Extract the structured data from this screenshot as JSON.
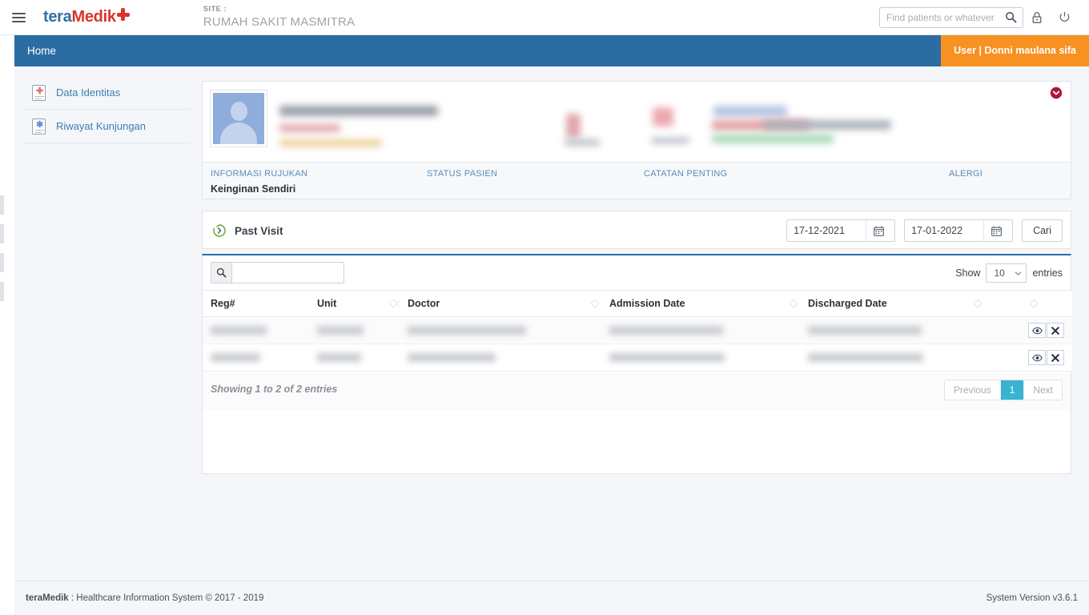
{
  "topbar": {
    "menu_icon": "hamburger-icon",
    "brand_part1": "teraMedik",
    "brand_cross": "medical-cross-icon",
    "site_label": "SITE :",
    "site_name": "RUMAH SAKIT MASMITRA",
    "search_placeholder": "Find patients or whatever",
    "search_value": "",
    "search_icon": "search-icon",
    "lock_icon": "lock-icon",
    "power_icon": "power-icon"
  },
  "nav": {
    "home_label": "Home",
    "user_badge": "User | Donni maulana sifa"
  },
  "sidebar": {
    "items": [
      {
        "label": "Data Identitas",
        "icon": "document-cross-icon"
      },
      {
        "label": "Riwayat Kunjungan",
        "icon": "document-asterisk-icon"
      }
    ]
  },
  "patient_card": {
    "collapse_icon": "chevron-down-circle-icon",
    "avatar": "person-placeholder-avatar",
    "redacted": true,
    "meta": [
      {
        "label": "INFORMASI RUJUKAN",
        "value": "Keinginan Sendiri"
      },
      {
        "label": "STATUS PASIEN",
        "value": ""
      },
      {
        "label": "CATATAN PENTING",
        "value": ""
      },
      {
        "label": "ALERGI",
        "value": ""
      }
    ]
  },
  "past_visit": {
    "icon": "history-circle-icon",
    "title": "Past Visit",
    "date_from": "17-12-2021",
    "date_to": "17-01-2022",
    "calendar_icon": "calendar-icon",
    "search_button": "Cari"
  },
  "table": {
    "search_icon": "search-icon",
    "search_value": "",
    "show_label": "Show",
    "page_size": "10",
    "entries_label": "entries",
    "chevron_icon": "chevron-down-icon",
    "columns": [
      "Reg#",
      "Unit",
      "Doctor",
      "Admission Date",
      "Discharged Date",
      "",
      ""
    ],
    "rows": [
      {
        "reg": "",
        "unit": "",
        "doctor": "",
        "admission": "",
        "discharged": "",
        "redacted": true,
        "actions": [
          {
            "icon": "eye-icon",
            "name": "view-button"
          },
          {
            "icon": "close-x-icon",
            "name": "delete-button"
          }
        ]
      },
      {
        "reg": "",
        "unit": "",
        "doctor": "",
        "admission": "",
        "discharged": "",
        "redacted": true,
        "actions": [
          {
            "icon": "eye-icon",
            "name": "view-button"
          },
          {
            "icon": "close-x-icon",
            "name": "delete-button"
          }
        ]
      }
    ],
    "showing": "Showing 1 to 2 of 2 entries",
    "pager": {
      "previous": "Previous",
      "current": "1",
      "next": "Next"
    }
  },
  "footer": {
    "brand": "teraMedik",
    "text": " : Healthcare Information System © 2017 - 2019",
    "version": "System Version v3.6.1"
  },
  "colors": {
    "nav_blue": "#2b6ca3",
    "user_orange": "#f79121",
    "brand_blue": "#2f6fa8",
    "brand_red": "#d9352a",
    "link_blue": "#3c7fb1",
    "pager_active": "#39b3d0",
    "collapse_red": "#b3143c",
    "history_green": "#6cb33f"
  }
}
